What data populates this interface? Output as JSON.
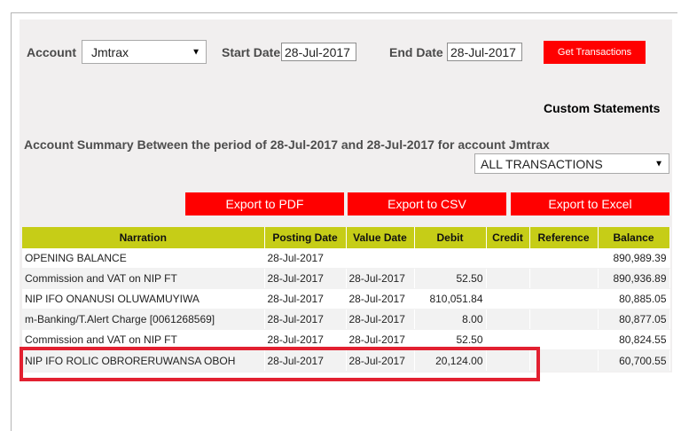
{
  "filters": {
    "account_label": "Account",
    "account_value": "Jmtrax",
    "start_label": "Start Date",
    "start_value": "28-Jul-2017",
    "end_label": "End Date",
    "end_value": "28-Jul-2017",
    "get_button": "Get Transactions"
  },
  "custom_title": "Custom Statements",
  "summary_text": "Account Summary Between the period of 28-Jul-2017 and 28-Jul-2017 for account Jmtrax",
  "type_select": "ALL TRANSACTIONS",
  "exports": {
    "pdf": "Export to PDF",
    "csv": "Export to CSV",
    "excel": "Export to Excel"
  },
  "table": {
    "headers": [
      "Narration",
      "Posting Date",
      "Value Date",
      "Debit",
      "Credit",
      "Reference",
      "Balance"
    ],
    "rows": [
      [
        "OPENING BALANCE",
        "28-Jul-2017",
        "",
        "",
        "",
        "",
        "890,989.39"
      ],
      [
        "Commission and VAT on NIP FT",
        "28-Jul-2017",
        "28-Jul-2017",
        "52.50",
        "",
        "",
        "890,936.89"
      ],
      [
        "NIP IFO ONANUSI OLUWAMUYIWA",
        "28-Jul-2017",
        "28-Jul-2017",
        "810,051.84",
        "",
        "",
        "80,885.05"
      ],
      [
        "m-Banking/T.Alert Charge [0061268569]",
        "28-Jul-2017",
        "28-Jul-2017",
        "8.00",
        "",
        "",
        "80,877.05"
      ],
      [
        "Commission and VAT on NIP FT",
        "28-Jul-2017",
        "28-Jul-2017",
        "52.50",
        "",
        "",
        "80,824.55"
      ],
      [
        "NIP IFO ROLIC OBRORERUWANSA OBOH",
        "28-Jul-2017",
        "28-Jul-2017",
        "20,124.00",
        "",
        "",
        "60,700.55"
      ]
    ]
  },
  "colors": {
    "accent_red": "#ff0000",
    "header_green": "#c6cd17",
    "highlight_red": "#e22030"
  }
}
